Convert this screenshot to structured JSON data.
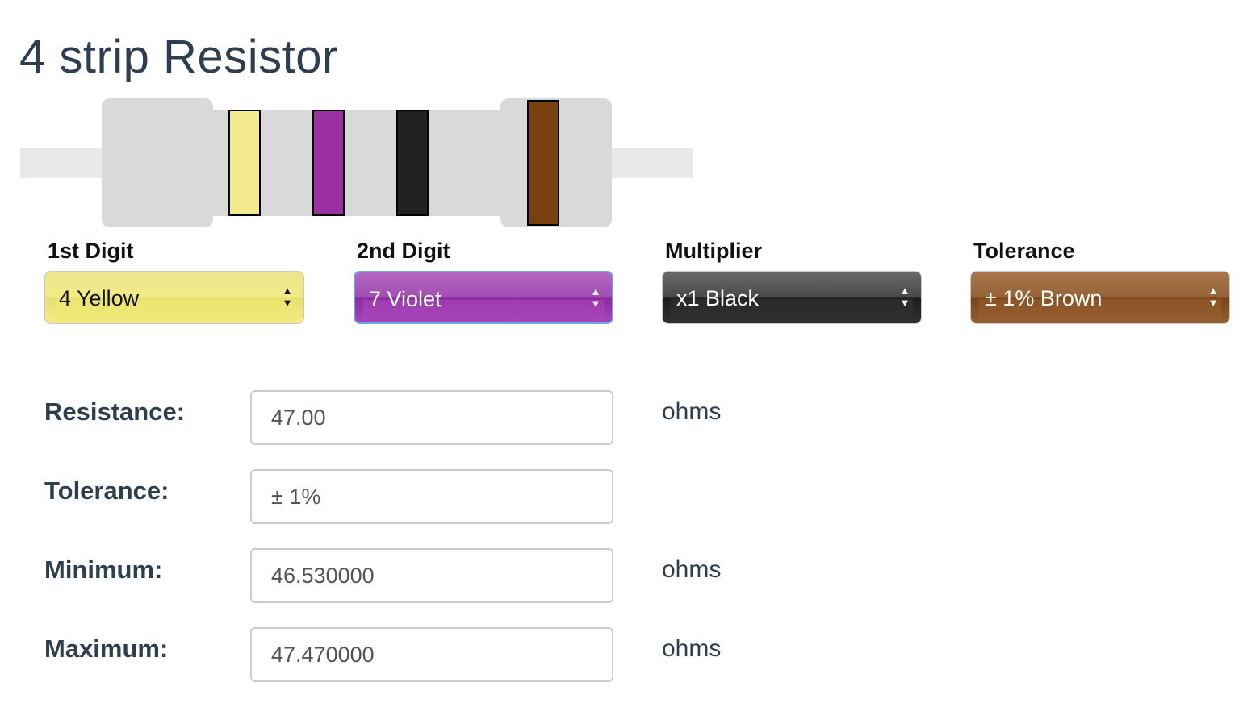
{
  "page": {
    "title": "4 strip Resistor"
  },
  "resistor": {
    "bands": [
      {
        "name": "Yellow",
        "color": "#f2ea8c"
      },
      {
        "name": "Violet",
        "color": "#9b30a3"
      },
      {
        "name": "Black",
        "color": "#222222"
      },
      {
        "name": "Brown",
        "color": "#7a4110"
      }
    ],
    "body_color": "#d9d9d9",
    "wire_color": "#e9e9e9"
  },
  "selectors": [
    {
      "label": "1st Digit",
      "value": "4 Yellow",
      "icon": "updown-arrows-icon"
    },
    {
      "label": "2nd Digit",
      "value": "7 Violet",
      "icon": "updown-arrows-icon"
    },
    {
      "label": "Multiplier",
      "value": "x1 Black",
      "icon": "updown-arrows-icon"
    },
    {
      "label": "Tolerance",
      "value": "± 1% Brown",
      "icon": "updown-arrows-icon"
    }
  ],
  "results": {
    "resistance": {
      "label": "Resistance:",
      "value": "47.00",
      "unit": "ohms"
    },
    "tolerance": {
      "label": "Tolerance:",
      "value": "± 1%",
      "unit": ""
    },
    "minimum": {
      "label": "Minimum:",
      "value": "46.530000",
      "unit": "ohms"
    },
    "maximum": {
      "label": "Maximum:",
      "value": "47.470000",
      "unit": "ohms"
    }
  }
}
